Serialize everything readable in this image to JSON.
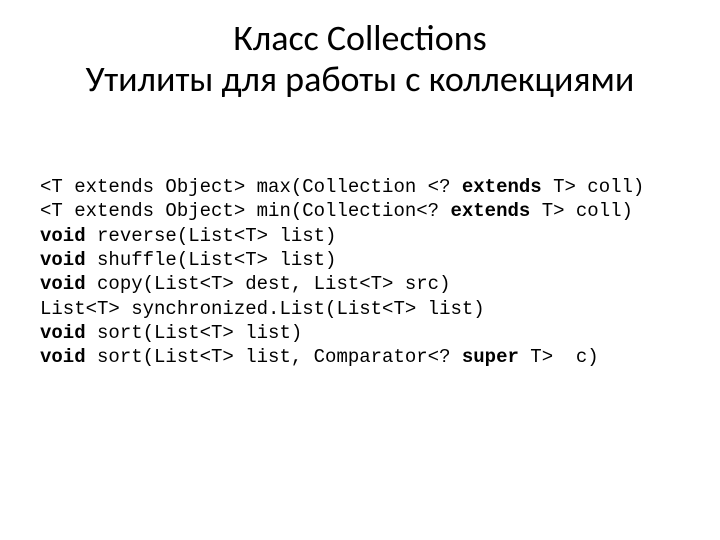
{
  "title": {
    "line1": "Класс Collections",
    "line2": "Утилиты для работы с коллекциями"
  },
  "code": {
    "l1a": "<T extends Object> max(Collection <? ",
    "l1b": "extends",
    "l1c": " T> coll)",
    "l2a": "<T extends Object> min(Collection<? ",
    "l2b": "extends",
    "l2c": " T> coll)",
    "l3a": "void",
    "l3b": " reverse(List<T> list)",
    "l4a": "void",
    "l4b": " shuffle(List<T> list)",
    "l5a": "void",
    "l5b": " copy(List<T> dest, List<T> src)",
    "l6": "List<T> synchronized.List(List<T> list)",
    "l7a": "void",
    "l7b": " sort(List<T> list)",
    "l8a": "void",
    "l8b": " sort(List<T> list, Comparator<? ",
    "l8c": "super",
    "l8d": " T>  c)"
  }
}
